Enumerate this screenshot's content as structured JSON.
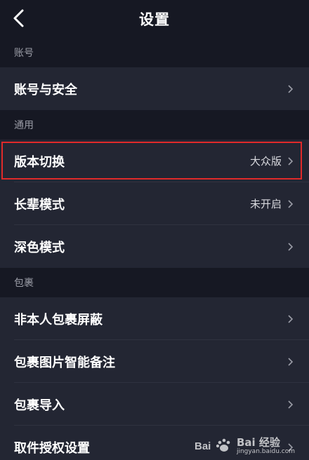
{
  "navbar": {
    "title": "设置"
  },
  "sections": [
    {
      "header": "账号",
      "items": [
        {
          "label": "账号与安全",
          "value": ""
        }
      ]
    },
    {
      "header": "通用",
      "items": [
        {
          "label": "版本切换",
          "value": "大众版"
        },
        {
          "label": "长辈模式",
          "value": "未开启"
        },
        {
          "label": "深色模式",
          "value": ""
        }
      ]
    },
    {
      "header": "包裹",
      "items": [
        {
          "label": "非本人包裹屏蔽",
          "value": ""
        },
        {
          "label": "包裹图片智能备注",
          "value": ""
        },
        {
          "label": "包裹导入",
          "value": ""
        },
        {
          "label": "取件授权设置",
          "value": ""
        }
      ]
    }
  ],
  "watermark": {
    "brand": "Bai 经验",
    "url": "jingyan.baidu.com"
  },
  "colors": {
    "background": "#161823",
    "row": "#232633",
    "highlight": "#e02a2a"
  }
}
